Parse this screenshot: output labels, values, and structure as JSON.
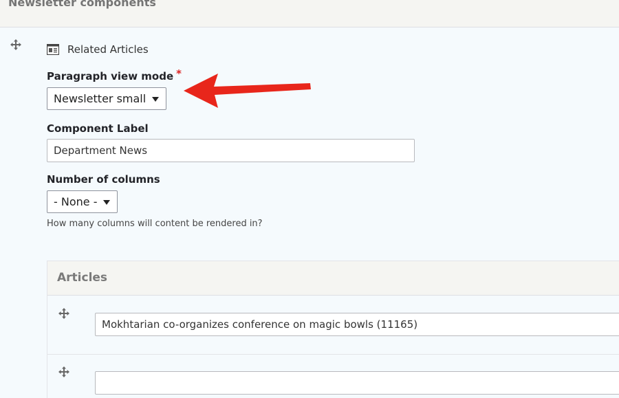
{
  "header": {
    "title": "Newsletter components"
  },
  "paragraph": {
    "type_label": "Related Articles",
    "view_mode": {
      "label": "Paragraph view mode",
      "required_mark": "*",
      "value": "Newsletter small"
    },
    "component_label": {
      "label": "Component Label",
      "value": "Department News"
    },
    "columns": {
      "label": "Number of columns",
      "value": "- None -",
      "help": "How many columns will content be rendered in?"
    }
  },
  "articles": {
    "title": "Articles",
    "items": [
      {
        "value": "Mokhtarian co-organizes conference on magic bowls (11165)"
      },
      {
        "value": ""
      }
    ]
  },
  "annotation": {
    "arrow_color": "#e8261b"
  },
  "icons": [
    "move-icon",
    "paragraph-type-icon",
    "dropdown-caret-icon",
    "arrow-annotation"
  ]
}
